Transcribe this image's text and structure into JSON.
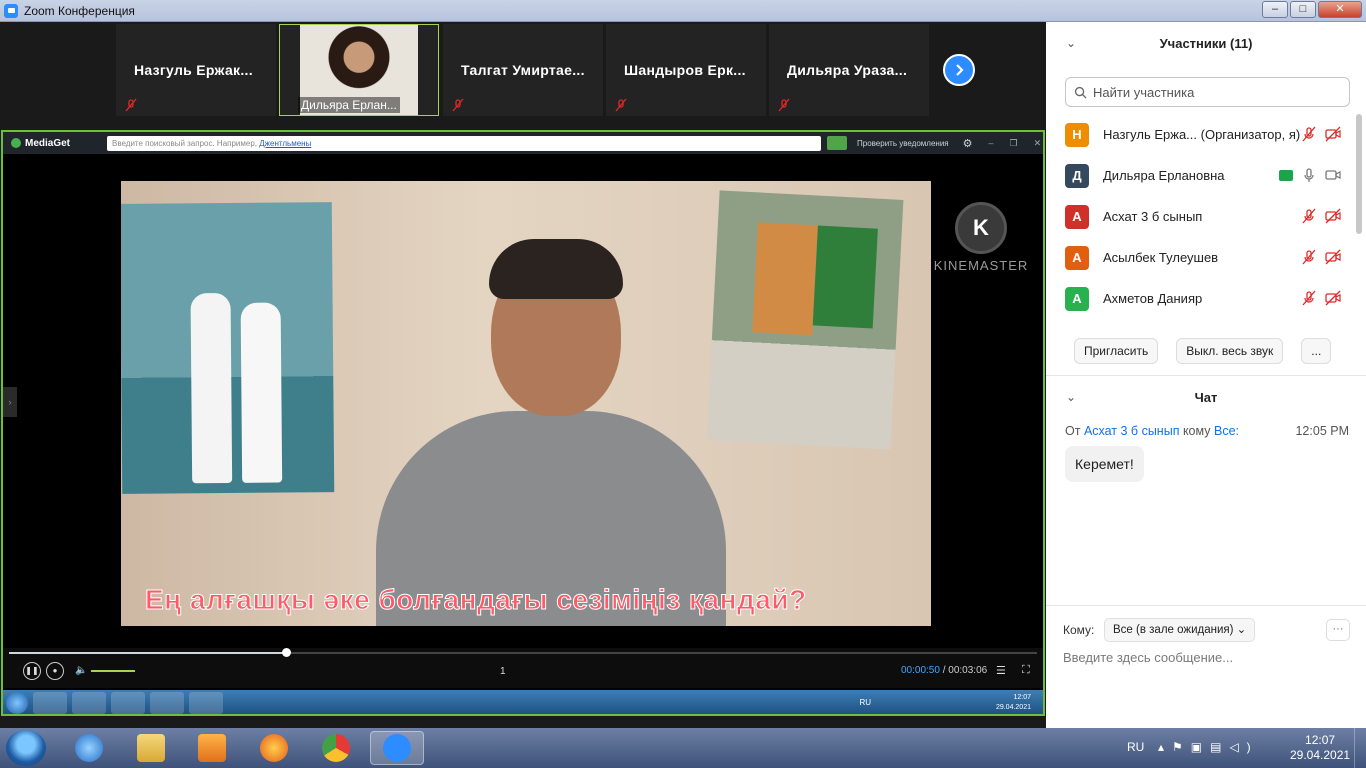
{
  "window": {
    "title": "Zoom Конференция",
    "controls": {
      "minimize": "–",
      "maximize": "□",
      "close": "✕"
    }
  },
  "strip": {
    "tiles": [
      {
        "name": "Назгуль  Ержак...",
        "muted": true
      },
      {
        "name": "Дильяра Ерлан...",
        "muted": false,
        "active": true,
        "has_video": true
      },
      {
        "name": "Талгат  Умиртае...",
        "muted": true
      },
      {
        "name": "Шандыров  Ерк...",
        "muted": true
      },
      {
        "name": "Дильяра  Ураза...",
        "muted": true
      }
    ]
  },
  "mediaget": {
    "logo": "MediaGet",
    "search_placeholder": "Введите поисковый запрос. Например,",
    "search_example": "Джентльмены",
    "notify": "Проверить уведомления",
    "caption": "Ең алғашқы әке болғандағы сезіміңіз қандай?",
    "watermark": "KINEMASTER",
    "watermark_letter": "K",
    "track": "1",
    "time_current": "00:00:50",
    "time_total": "00:03:06",
    "progress": 0.269,
    "volume": 0.95,
    "inner_tray": {
      "lang": "RU",
      "time": "12:07",
      "date": "29.04.2021"
    }
  },
  "panel": {
    "participants_title": "Участники (11)",
    "search_placeholder": "Найти участника",
    "participants": [
      {
        "initial": "Н",
        "name": "Назгуль Ержа... (Организатор, я)",
        "color": "#f08c00",
        "mic_muted": true,
        "video_off": true,
        "sharing": false
      },
      {
        "initial": "Д",
        "name": "Дильяра Ерлановна",
        "color": "#34495e",
        "mic_muted": false,
        "video_off": false,
        "sharing": true
      },
      {
        "initial": "А",
        "name": "Асхат 3 б сынып",
        "color": "#d0302a",
        "mic_muted": true,
        "video_off": true,
        "sharing": false
      },
      {
        "initial": "А",
        "name": "Асылбек Тулеушев",
        "color": "#e06010",
        "mic_muted": true,
        "video_off": true,
        "sharing": false
      },
      {
        "initial": "А",
        "name": "Ахметов Данияр",
        "color": "#28b24f",
        "mic_muted": true,
        "video_off": true,
        "sharing": false
      }
    ],
    "buttons": {
      "invite": "Пригласить",
      "mute_all": "Выкл. весь звук",
      "more": "..."
    },
    "chat": {
      "title": "Чат",
      "from_label": "От",
      "sender": "Асхат 3 б сынып",
      "to_label": "кому",
      "recipient": "Все:",
      "time": "12:05 PM",
      "message": "Керемет!",
      "to_prefix": "Кому:",
      "to_value": "Все (в зале ожидания)",
      "more": "···",
      "input_placeholder": "Введите здесь сообщение..."
    }
  },
  "taskbar": {
    "lang": "RU",
    "time": "12:07",
    "date": "29.04.2021"
  }
}
